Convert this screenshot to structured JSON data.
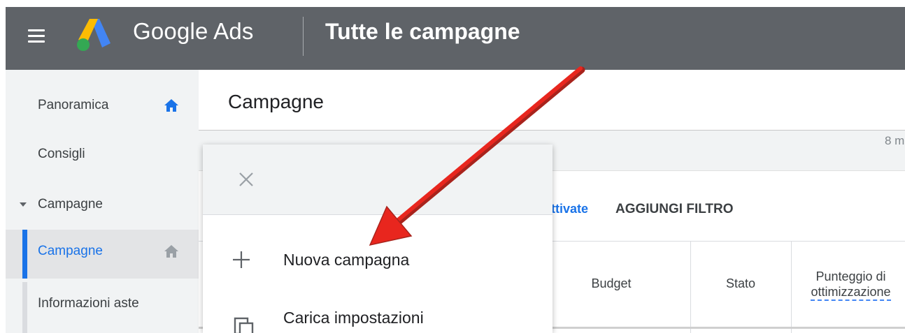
{
  "topbar": {
    "brand": "Google Ads",
    "title": "Tutte le campagne",
    "menu_icon": "hamburger-menu-icon",
    "logo_icon": "google-ads-logo",
    "colors": {
      "background": "#5f6368",
      "text": "#ffffff"
    }
  },
  "sidebar": {
    "items": [
      {
        "label": "Panoramica",
        "icon": "home-icon",
        "icon_color": "#1a73e8"
      },
      {
        "label": "Consigli"
      },
      {
        "label": "Campagne",
        "expander": "caret-down-icon"
      },
      {
        "label": "Campagne",
        "icon": "home-icon",
        "icon_color": "#9aa0a6",
        "selected": true
      },
      {
        "label": "Informazioni aste"
      }
    ],
    "accent_color": "#1a73e8"
  },
  "main": {
    "title": "Campagne",
    "date_range_text": "8 m",
    "filters": {
      "active_label": "ttivate",
      "add_filter_label": "AGGIUNGI FILTRO"
    },
    "table_headers": {
      "budget": "Budget",
      "status": "Stato",
      "optimization_line1": "Punteggio di",
      "optimization_line2": "ottimizzazione"
    }
  },
  "menu": {
    "close_icon": "close-icon",
    "items": [
      {
        "label": "Nuova campagna",
        "icon": "plus-icon"
      },
      {
        "label": "Carica impostazioni",
        "icon": "copy-icon"
      }
    ]
  },
  "annotation": {
    "type": "arrow",
    "color": "#e8261e",
    "points_to": "Nuova campagna"
  }
}
